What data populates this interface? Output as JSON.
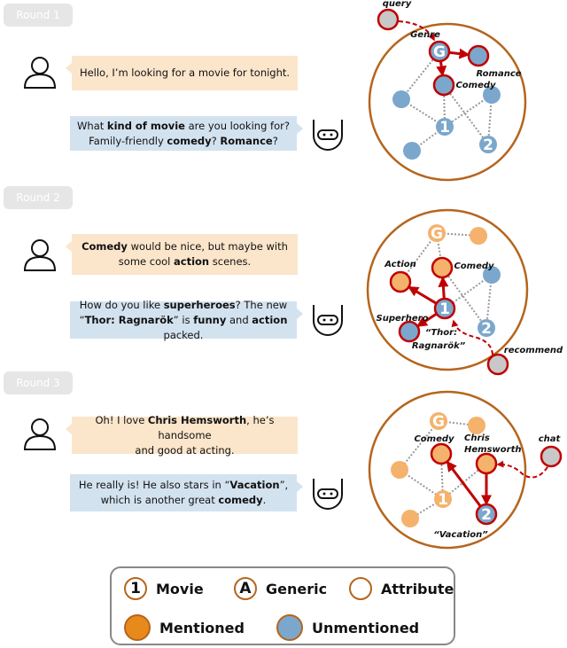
{
  "colors": {
    "unmentioned": "#7ba7cc",
    "mentioned_graph": "#f4b26c",
    "mentioned_legend": "#e8891c",
    "highlight": "#c00000",
    "boundary": "#b5651d",
    "external": "#c8c8c8",
    "edge": "#999999"
  },
  "rounds": [
    {
      "label": "Round 1",
      "user": [
        {
          "t": "Hello, I’m looking for a movie for tonight."
        }
      ],
      "bot": [
        {
          "t": "What "
        },
        {
          "t": "kind of movie",
          "b": true
        },
        {
          "t": " are you looking for?\nFamily-friendly "
        },
        {
          "t": "comedy",
          "b": true
        },
        {
          "t": "? "
        },
        {
          "t": "Romance",
          "b": true
        },
        {
          "t": "?"
        }
      ],
      "graph": {
        "external": "query",
        "labels": {
          "genre": "Genre",
          "romance": "Romance",
          "comedy": "Comedy"
        },
        "movie1": "1",
        "movie2": "2",
        "generic": "G"
      }
    },
    {
      "label": "Round 2",
      "user": [
        {
          "t": "Comedy",
          "b": true
        },
        {
          "t": " would be nice, but maybe with\nsome cool "
        },
        {
          "t": "action",
          "b": true
        },
        {
          "t": " scenes."
        }
      ],
      "bot": [
        {
          "t": "How do you like "
        },
        {
          "t": "superheroes",
          "b": true
        },
        {
          "t": "? The new\n“"
        },
        {
          "t": "Thor: Ragnarök",
          "b": true
        },
        {
          "t": "” is "
        },
        {
          "t": "funny",
          "b": true
        },
        {
          "t": " and "
        },
        {
          "t": "action",
          "b": true
        },
        {
          "t": " packed."
        }
      ],
      "graph": {
        "external": "recommend",
        "labels": {
          "action": "Action",
          "comedy": "Comedy",
          "superhero": "Superhero",
          "thor1": "“Thor:",
          "thor2": "Ragnarök”"
        },
        "movie1": "1",
        "movie2": "2",
        "generic": "G"
      }
    },
    {
      "label": "Round 3",
      "user": [
        {
          "t": "Oh! I love "
        },
        {
          "t": "Chris Hemsworth",
          "b": true
        },
        {
          "t": ", he’s handsome\nand good at acting."
        }
      ],
      "bot": [
        {
          "t": "He really is!  He also stars in “"
        },
        {
          "t": "Vacation",
          "b": true
        },
        {
          "t": "”,\nwhich is another great "
        },
        {
          "t": "comedy",
          "b": true
        },
        {
          "t": "."
        }
      ],
      "graph": {
        "external": "chat",
        "labels": {
          "comedy": "Comedy",
          "chris1": "Chris",
          "chris2": "Hemsworth",
          "vacation": "“Vacation”"
        },
        "movie1": "1",
        "movie2": "2",
        "generic": "G"
      }
    }
  ],
  "legend": {
    "movie_symbol": "1",
    "movie": "Movie",
    "generic_symbol": "A",
    "generic": "Generic",
    "attribute": "Attribute",
    "mentioned": "Mentioned",
    "unmentioned": "Unmentioned"
  }
}
